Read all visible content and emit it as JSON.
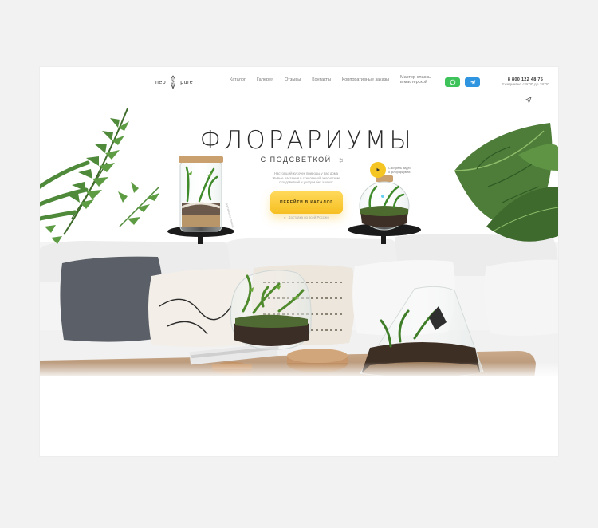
{
  "brand": {
    "line1": "neo",
    "line2": "pure"
  },
  "nav": {
    "items": [
      {
        "label": "Каталог"
      },
      {
        "label": "Галерея"
      },
      {
        "label": "Отзывы"
      },
      {
        "label": "Контакты"
      },
      {
        "label": "Корпоративные заказы"
      }
    ],
    "workshop_line1": "Мастер-классы",
    "workshop_line2": "в мастерской"
  },
  "contacts": {
    "phone": "8 800 122 48 75",
    "hours": "Ежедневно с 9:00 до 18:00",
    "icons": [
      "whatsapp-icon",
      "telegram-icon",
      "send-icon"
    ]
  },
  "hero": {
    "title": "ФЛОРАРИУМЫ",
    "subtitle": "С ПОДСВЕТКОЙ",
    "description_line1": "Настоящий кусочек природы у вас дома",
    "description_line2": "Живые растения в стеклянной экосистеме",
    "description_line3": "с подсветкой и уходом без хлопот",
    "cta_label": "ПЕРЕЙТИ В КАТАЛОГ",
    "cta_note": "Доставка по всей России",
    "video_label_line1": "Смотреть видео",
    "video_label_line2": "о флорариумах",
    "rotate_text": "доставка по России"
  },
  "colors": {
    "accent": "#f6c22b",
    "whatsapp": "#3dc35a",
    "telegram": "#2f95e0",
    "page_bg": "#f2f2f3"
  }
}
